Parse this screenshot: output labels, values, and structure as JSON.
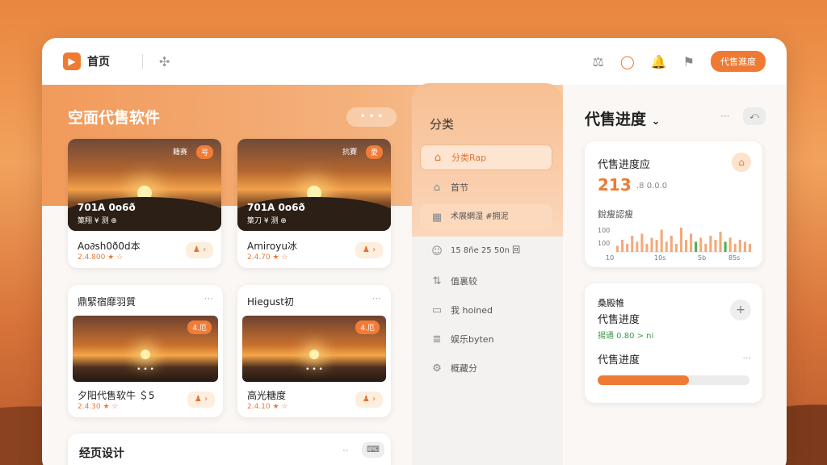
{
  "topbar": {
    "home_label": "首页",
    "logo_glyph": "▶",
    "action_button": "代售進度",
    "icons": [
      "translate-icon",
      "search-icon",
      "bell-icon",
      "bookmark-icon"
    ]
  },
  "left": {
    "section_title": "空面代售软件",
    "more": "• • •",
    "cards": [
      {
        "badge": "号",
        "badge_label": "籍赛",
        "thumb_title": "701A 0o6ð",
        "thumb_sub": "篥翔 ¥ 测 ⊕",
        "title": "Ao∂sh0ð0d本",
        "sub": "2.4.800 ★ ☆",
        "action": "♟ ›"
      },
      {
        "badge": "愛",
        "badge_label": "抗賽",
        "thumb_title": "701A 0o6ð",
        "thumb_sub": "篥刀 ¥ 测 ⊕",
        "title": "Amiroyu冰",
        "sub": "2.4.70 ★ ☆",
        "action": "♟ ›"
      },
      {
        "head": "鼎緊宿靡羽質",
        "dots": "···",
        "badge": "4.厄",
        "dots_line": "• • •",
        "title": "夕阳代售软牛 ＄5",
        "sub": "2.4.30 ★ ☆",
        "action": "♟ ›"
      },
      {
        "head": "Hiegust初",
        "dots": "···",
        "badge": "4.厄",
        "dots_line": "• • •",
        "title": "高光糖度",
        "sub": "2.4.10 ★ ☆",
        "action": "♟ ›"
      }
    ],
    "bottom": {
      "title": "经页设计",
      "dash": "··",
      "icon": "⌨"
    }
  },
  "categories": {
    "title": "分类",
    "items": [
      {
        "icon": "⌂",
        "label": "分类Rap",
        "state": "active"
      },
      {
        "icon": "⌂",
        "label": "首节",
        "state": ""
      },
      {
        "icon": "▦",
        "label": "术展網湿 #拥泥",
        "state": "hl"
      },
      {
        "icon": "☺",
        "label": "15 8ñe 25 50n 回",
        "state": ""
      },
      {
        "icon": "⇅",
        "label": "值裏较",
        "state": ""
      },
      {
        "icon": "▭",
        "label": "我 hoined",
        "state": ""
      },
      {
        "icon": "≣",
        "label": "娱乐byten",
        "state": ""
      },
      {
        "icon": "⚙",
        "label": "概藏分",
        "state": ""
      }
    ]
  },
  "right": {
    "title": "代售进度",
    "title_caret": "⌄",
    "dots": "···",
    "toggle": "⤺",
    "card1": {
      "title": "代售进度应",
      "big": "213",
      "big_sub": ".8 0.0.0",
      "subtitle": "銳瘦認瘦",
      "y_labels": [
        "100",
        "100"
      ],
      "x_labels": [
        "10",
        "10s",
        "5b",
        "85s"
      ],
      "icon": "⌂"
    },
    "card2": {
      "title1": "桑殿帷",
      "title2": "代售进度",
      "sub": "揚通 0.80 > ni",
      "title3": "代售进度",
      "dots": "···",
      "plus": "+",
      "progress": 0.6
    },
    "chart_data": {
      "type": "bar",
      "values": [
        3,
        6,
        4,
        8,
        5,
        9,
        4,
        7,
        6,
        11,
        5,
        8,
        4,
        12,
        6,
        9,
        5,
        7,
        4,
        8,
        6,
        10,
        5,
        7,
        4,
        6,
        5,
        4
      ],
      "highlight": [
        16,
        22
      ],
      "colors": {
        "bar": "#f3a97a",
        "highlight": "#4caf50"
      }
    }
  }
}
